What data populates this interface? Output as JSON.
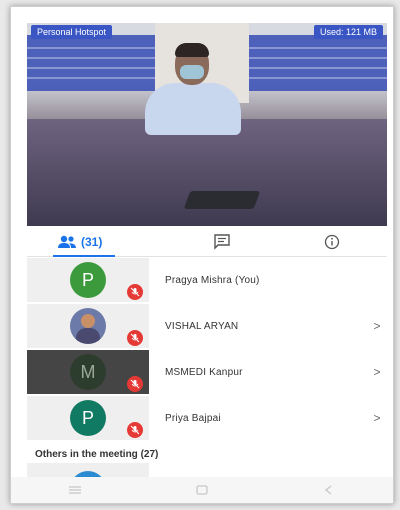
{
  "video": {
    "left_tag": "Personal Hotspot",
    "right_tag": "Used: 121 MB"
  },
  "tabs": {
    "people_count": "(31)"
  },
  "participants": [
    {
      "initial": "P",
      "name": "Pragya Mishra (You)",
      "color": "#3c9a3c",
      "has_chevron": false
    },
    {
      "initial": "",
      "name": "VISHAL ARYAN",
      "color": "#6b7aa8",
      "has_chevron": true
    },
    {
      "initial": "M",
      "name": "MSMEDI Kanpur",
      "color": "#2d3d2d",
      "has_chevron": true
    },
    {
      "initial": "P",
      "name": "Priya Bajpai",
      "color": "#117a63",
      "has_chevron": true
    }
  ],
  "others": {
    "label": "Others in the meeting (27)"
  },
  "colors": {
    "accent": "#1a73e8",
    "muted_badge": "#e53935"
  }
}
